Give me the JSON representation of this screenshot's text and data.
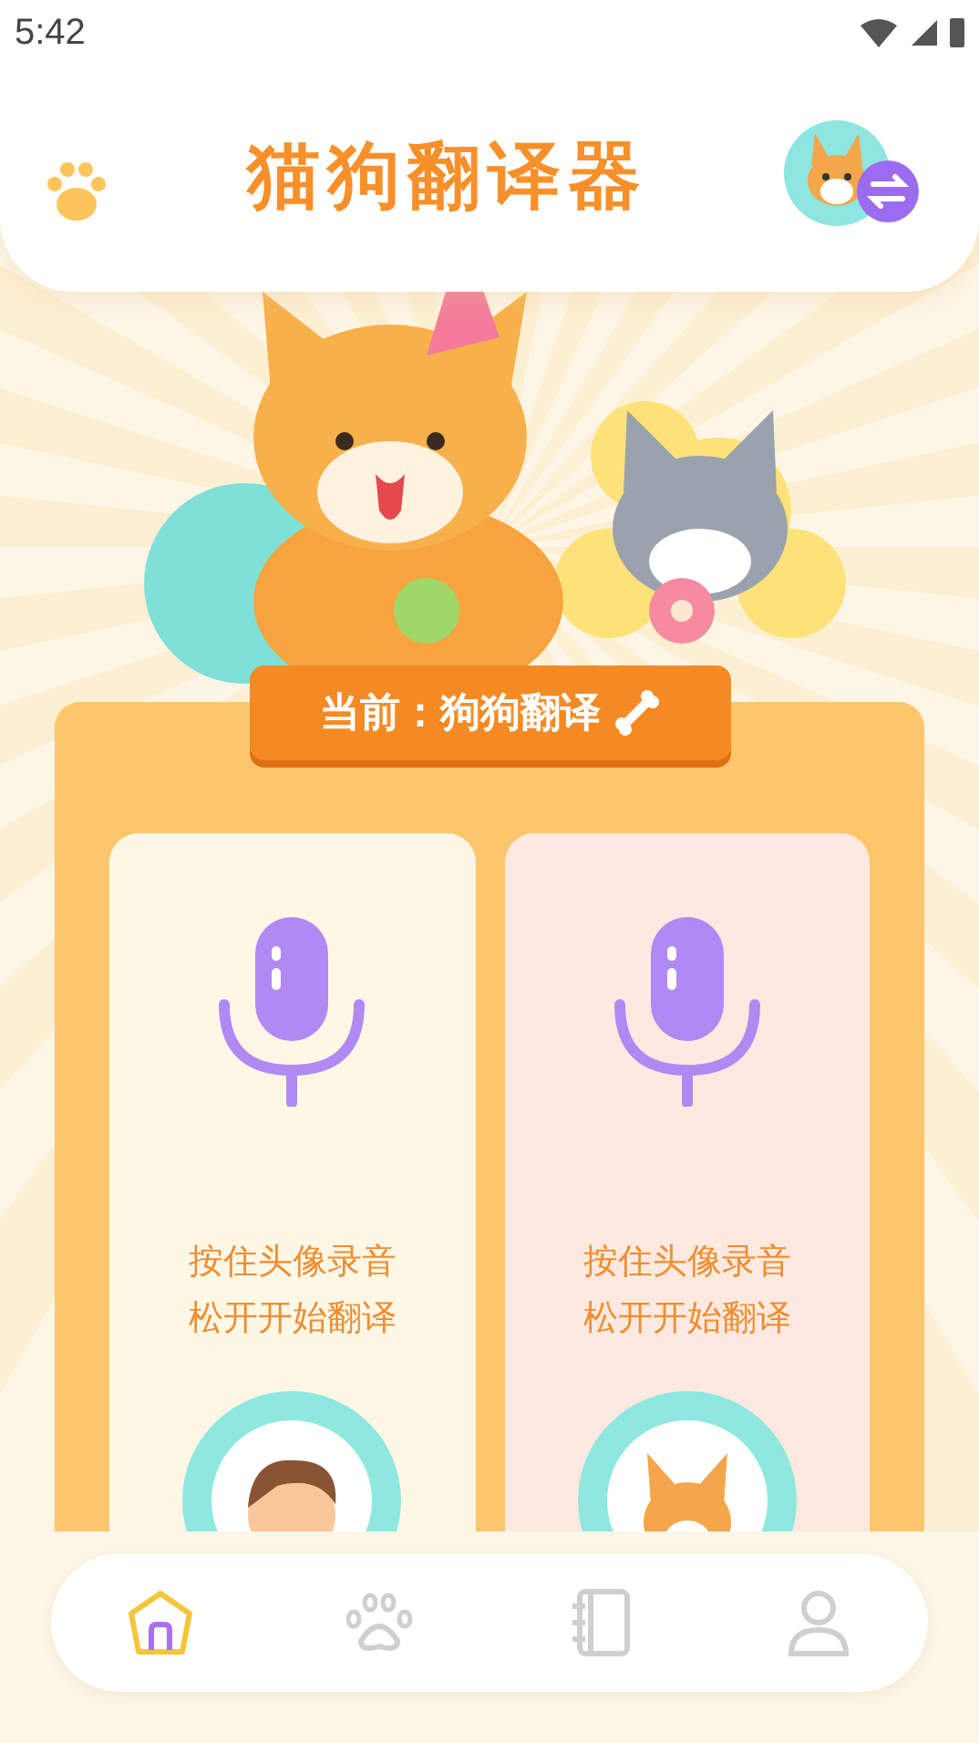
{
  "status_bar": {
    "time": "5:42"
  },
  "header": {
    "title": "猫狗翻译器"
  },
  "mode_banner": {
    "label": "当前：狗狗翻译"
  },
  "recorders": [
    {
      "kind": "person",
      "lines": [
        "按住头像录音",
        "松开开始翻译"
      ]
    },
    {
      "kind": "dog",
      "lines": [
        "按住头像录音",
        "松开开始翻译"
      ]
    }
  ],
  "nav": {
    "items": [
      {
        "kind": "home",
        "selected": true
      },
      {
        "kind": "paw",
        "selected": false
      },
      {
        "kind": "notebook",
        "selected": false
      },
      {
        "kind": "profile",
        "selected": false
      }
    ]
  }
}
